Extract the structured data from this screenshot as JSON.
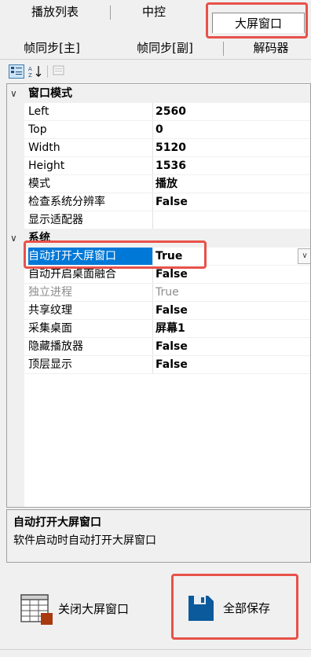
{
  "tabs_row1": [
    {
      "label": "播放列表"
    },
    {
      "label": "中控"
    },
    {
      "label": "大屏窗口"
    }
  ],
  "tabs_row2": [
    {
      "label": "帧同步[主]"
    },
    {
      "label": "帧同步[副]"
    },
    {
      "label": "解码器"
    }
  ],
  "toolbar": {
    "categorized_icon": "categorized-view-icon",
    "alphabetical_icon": "alphabetical-sort-icon",
    "property_pages_icon": "property-pages-icon"
  },
  "grid": {
    "categories": [
      {
        "label": "窗口模式",
        "props": [
          {
            "name": "Left",
            "value": "2560"
          },
          {
            "name": "Top",
            "value": "0"
          },
          {
            "name": "Width",
            "value": "5120"
          },
          {
            "name": "Height",
            "value": "1536"
          },
          {
            "name": "模式",
            "value": "播放"
          },
          {
            "name": "检查系统分辨率",
            "value": "False"
          },
          {
            "name": "显示适配器",
            "value": ""
          }
        ]
      },
      {
        "label": "系统",
        "props": [
          {
            "name": "自动打开大屏窗口",
            "value": "True"
          },
          {
            "name": "自动开启桌面融合",
            "value": "False"
          },
          {
            "name": "独立进程",
            "value": "True"
          },
          {
            "name": "共享纹理",
            "value": "False"
          },
          {
            "name": "采集桌面",
            "value": "屏幕1"
          },
          {
            "name": "隐藏播放器",
            "value": "False"
          },
          {
            "name": "顶层显示",
            "value": "False"
          }
        ]
      }
    ]
  },
  "description": {
    "title": "自动打开大屏窗口",
    "text": "软件启动时自动打开大屏窗口"
  },
  "buttons": {
    "close_window": "关闭大屏窗口",
    "save_all": "全部保存"
  },
  "colors": {
    "highlight_box": "#e8514a",
    "selection": "#0078d7",
    "save_icon": "#0a5a9c",
    "close_icon_accent": "#a83a10"
  }
}
